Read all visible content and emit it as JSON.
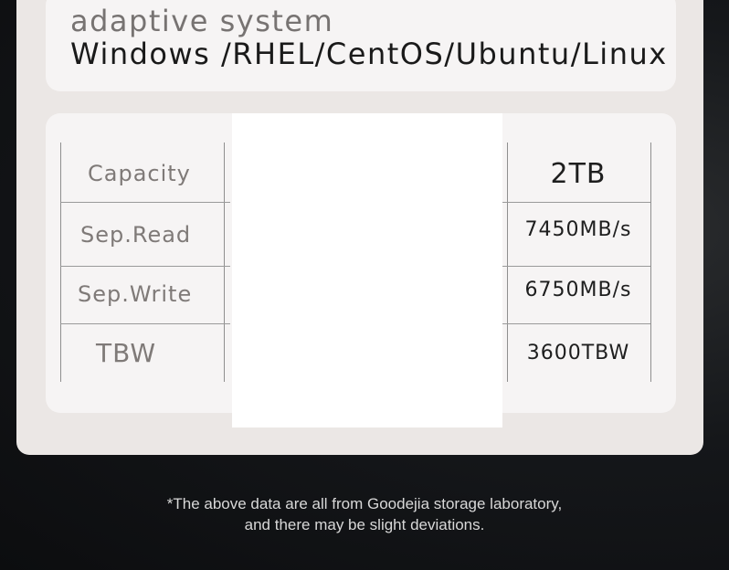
{
  "os_support": {
    "line1": "adaptive system",
    "line2": "Windows /RHEL/CentOS/Ubuntu/Linux"
  },
  "specs": [
    {
      "label": "Capacity",
      "value": "2TB"
    },
    {
      "label": "Sep.Read",
      "value": "7450MB/s"
    },
    {
      "label": "Sep.Write",
      "value": "6750MB/s"
    },
    {
      "label": "TBW",
      "value": "3600TBW"
    }
  ],
  "disclaimer": {
    "line1": "*The above data are all from Goodejia storage laboratory,",
    "line2": "and there may be slight deviations."
  }
}
